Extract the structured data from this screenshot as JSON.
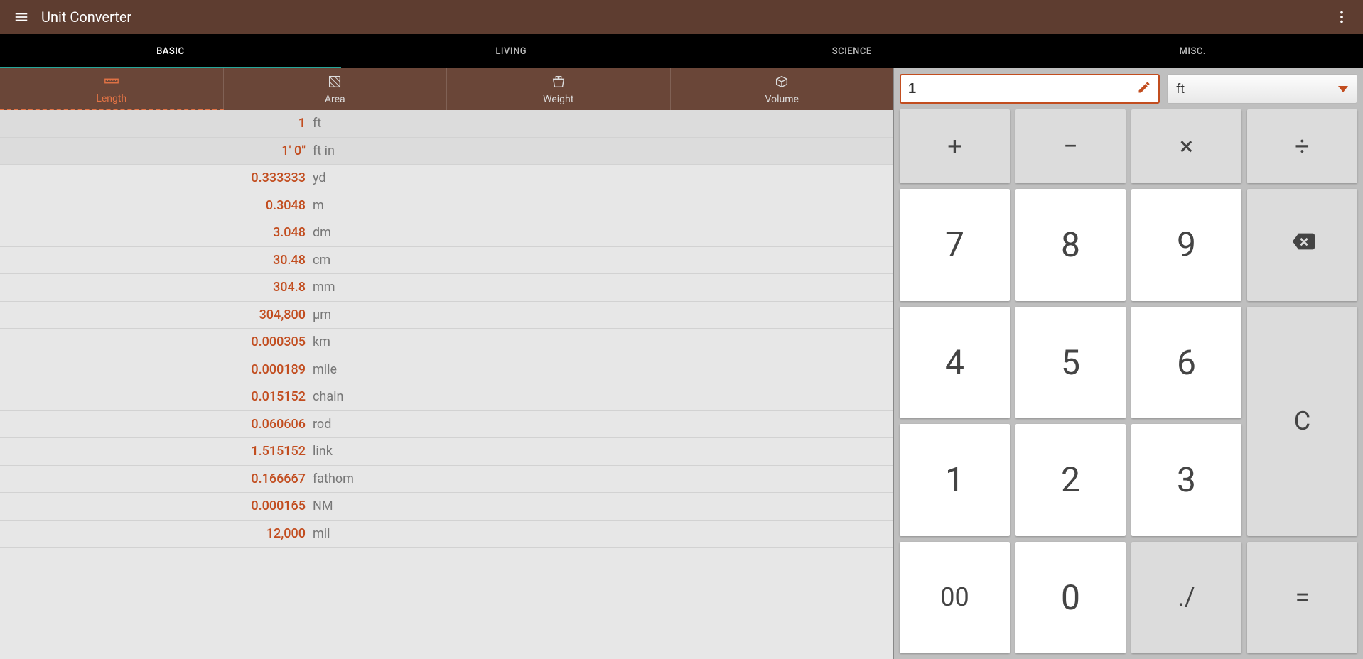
{
  "header": {
    "title": "Unit Converter"
  },
  "topTabs": [
    {
      "label": "BASIC",
      "active": true
    },
    {
      "label": "LIVING",
      "active": false
    },
    {
      "label": "SCIENCE",
      "active": false
    },
    {
      "label": "MISC.",
      "active": false
    }
  ],
  "catTabs": [
    {
      "label": "Length",
      "active": true,
      "icon": "ruler"
    },
    {
      "label": "Area",
      "active": false,
      "icon": "area"
    },
    {
      "label": "Weight",
      "active": false,
      "icon": "weight"
    },
    {
      "label": "Volume",
      "active": false,
      "icon": "volume"
    }
  ],
  "results": [
    {
      "value": "1",
      "unit": "ft",
      "highlight": true
    },
    {
      "value": "1' 0\"",
      "unit": "ft in",
      "highlight": true
    },
    {
      "value": "0.333333",
      "unit": "yd"
    },
    {
      "value": "0.3048",
      "unit": "m"
    },
    {
      "value": "3.048",
      "unit": "dm"
    },
    {
      "value": "30.48",
      "unit": "cm"
    },
    {
      "value": "304.8",
      "unit": "mm"
    },
    {
      "value": "304,800",
      "unit": "µm"
    },
    {
      "value": "0.000305",
      "unit": "km"
    },
    {
      "value": "0.000189",
      "unit": "mile"
    },
    {
      "value": "0.015152",
      "unit": "chain"
    },
    {
      "value": "0.060606",
      "unit": "rod"
    },
    {
      "value": "1.515152",
      "unit": "link"
    },
    {
      "value": "0.166667",
      "unit": "fathom"
    },
    {
      "value": "0.000165",
      "unit": "NM"
    },
    {
      "value": "12,000",
      "unit": "mil"
    }
  ],
  "input": {
    "value": "1",
    "unit": "ft"
  },
  "keypad": {
    "ops": {
      "plus": "+",
      "minus": "−",
      "mult": "×",
      "div": "÷"
    },
    "nums": {
      "7": "7",
      "8": "8",
      "9": "9",
      "4": "4",
      "5": "5",
      "6": "6",
      "1": "1",
      "2": "2",
      "3": "3",
      "00": "00",
      "0": "0"
    },
    "dot": "./",
    "clear": "C",
    "equals": "="
  }
}
